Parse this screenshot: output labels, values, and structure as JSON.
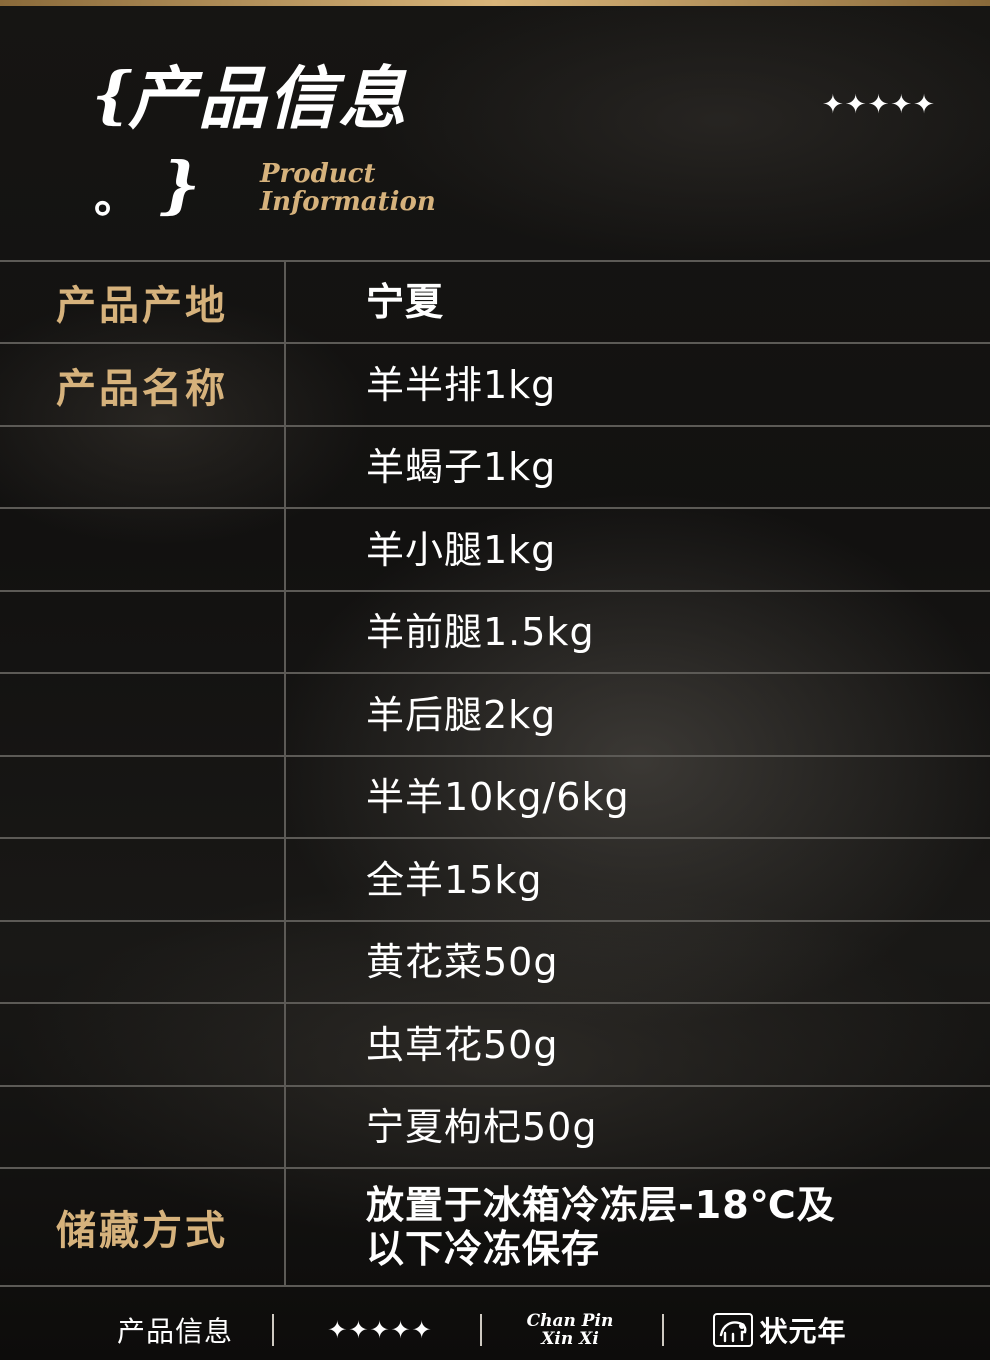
{
  "header": {
    "brace_left": "{",
    "title_cn": "产品信息",
    "dot": "。",
    "brace_right": "}",
    "title_en_line1": "Product",
    "title_en_line2": "Information",
    "stars": "✦✦✦✦✦"
  },
  "table": {
    "origin_label": "产品产地",
    "origin_value": "宁夏",
    "name_label": "产品名称",
    "products": [
      "羊半排1kg",
      "羊蝎子1kg",
      "羊小腿1kg",
      "羊前腿1.5kg",
      "羊后腿2kg",
      "半羊10kg/6kg",
      "全羊15kg",
      "黄花菜50g",
      "虫草花50g",
      "宁夏枸杞50g"
    ],
    "storage_label": "储藏方式",
    "storage_value": "放置于冰箱冷冻层-18℃及以下冷冻保存"
  },
  "footer": {
    "title": "产品信息",
    "stars": "✦✦✦✦✦",
    "pinyin_line1": "Chan Pin",
    "pinyin_line2": "Xin Xi",
    "brand": "状元年"
  },
  "colors": {
    "gold": "#d6b27c",
    "line": "#5c5a56",
    "background": "#0f0e0d"
  }
}
